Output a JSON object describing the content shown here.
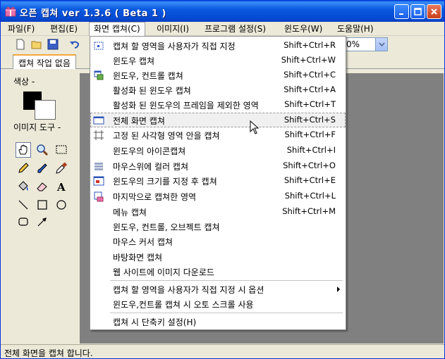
{
  "window": {
    "title": "오픈 캡쳐 ver 1.3.6 ( Beta 1 )"
  },
  "menubar": {
    "items": [
      "파일(F)",
      "편집(E)",
      "화면 캡쳐(C)",
      "이미지(I)",
      "프로그램 설정(S)",
      "윈도우(W)",
      "도움말(H)"
    ]
  },
  "toolbar": {
    "zoom_value": "0%"
  },
  "tab": {
    "label": "캡쳐 작업 없음"
  },
  "leftpanel": {
    "color_label": "색상 -",
    "tools_label": "이미지 도구 -"
  },
  "status": {
    "text": "전체 화면을 캡쳐 합니다."
  },
  "capture_menu": {
    "items": [
      {
        "label": "캡쳐 할 영역을 사용자가 직접 지정",
        "shortcut": "Shift+Ctrl+R",
        "icon": "region-select-icon"
      },
      {
        "label": "윈도우 캡쳐",
        "shortcut": "Shift+Ctrl+W",
        "icon": ""
      },
      {
        "label": "윈도우, 컨트롤 캡쳐",
        "shortcut": "Shift+Ctrl+C",
        "icon": "window-control-icon"
      },
      {
        "label": "활성화 된 윈도우 캡쳐",
        "shortcut": "Shift+Ctrl+A",
        "icon": ""
      },
      {
        "label": "활성화 된 윈도우의 프레임을 제외한 영역",
        "shortcut": "Shift+Ctrl+T",
        "icon": ""
      },
      {
        "label": "전체 화면 캡쳐",
        "shortcut": "Shift+Ctrl+S",
        "icon": "fullscreen-icon"
      },
      {
        "label": "고정 된 사각형 영역 안을 캡쳐",
        "shortcut": "Shift+Ctrl+F",
        "icon": "fixed-rect-icon"
      },
      {
        "label": "윈도우의 아이콘캡쳐",
        "shortcut": "Shift+Ctrl+I",
        "icon": ""
      },
      {
        "label": "마우스위에 컬러 캡쳐",
        "shortcut": "Shift+Ctrl+O",
        "icon": "color-bars-icon"
      },
      {
        "label": "윈도우의 크기를 지정 후 캡쳐",
        "shortcut": "Shift+Ctrl+E",
        "icon": "resize-window-icon"
      },
      {
        "label": "마지막으로 캡쳐한 영역",
        "shortcut": "Shift+Ctrl+L",
        "icon": "last-region-icon"
      },
      {
        "label": "메뉴 캡쳐",
        "shortcut": "Shift+Ctrl+M",
        "icon": ""
      },
      {
        "label": "윈도우, 컨트롤, 오브젝트 캡쳐",
        "shortcut": "",
        "icon": ""
      },
      {
        "label": "마우스 커서 캡쳐",
        "shortcut": "",
        "icon": ""
      },
      {
        "label": "바탕화면 캡쳐",
        "shortcut": "",
        "icon": ""
      },
      {
        "label": "웹 사이트에 이미지 다운로드",
        "shortcut": "",
        "icon": ""
      },
      {
        "label": "캡쳐 할 영역을 사용자가 직접 지정 시 옵션",
        "shortcut": "",
        "icon": ""
      },
      {
        "label": "윈도우,컨트롤 캡쳐 시 오토 스크롤 사용",
        "shortcut": "",
        "icon": ""
      },
      {
        "label": "캡쳐 시 단축키 설정(H)",
        "shortcut": "",
        "icon": ""
      }
    ]
  }
}
